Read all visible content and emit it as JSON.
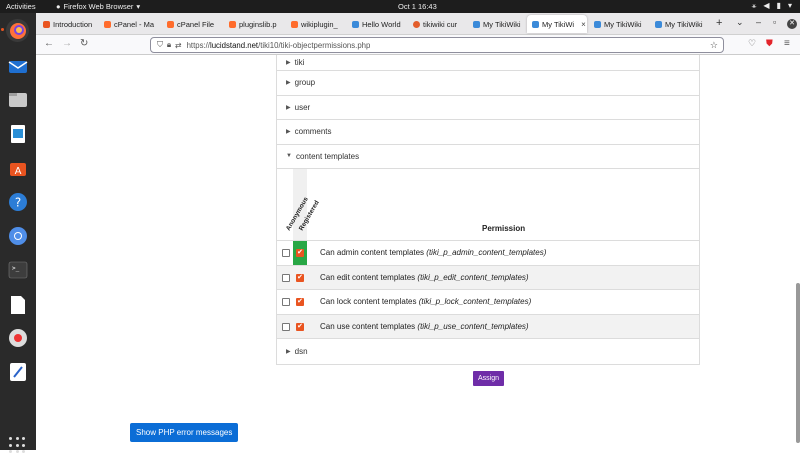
{
  "topbar": {
    "activities": "Activities",
    "app_name": "Firefox Web Browser",
    "clock": "Oct 1  16:43"
  },
  "browser": {
    "tabs": [
      {
        "label": "Introduction",
        "color": "#e95420"
      },
      {
        "label": "cPanel - Ma",
        "color": "#ff6c2c"
      },
      {
        "label": "cPanel File",
        "color": "#ff6c2c"
      },
      {
        "label": "pluginslib.p",
        "color": "#ff6c2c"
      },
      {
        "label": "wikiplugin_",
        "color": "#ff6c2c"
      },
      {
        "label": "Hello World",
        "color": "#3b8ad9"
      },
      {
        "label": "tikiwiki cur",
        "color": "#e35d2b"
      },
      {
        "label": "My TikiWiki",
        "color": "#3b8ad9"
      },
      {
        "label": "My TikiWi",
        "color": "#3b8ad9"
      },
      {
        "label": "My TikiWiki",
        "color": "#3b8ad9"
      },
      {
        "label": "My TikiWiki",
        "color": "#3b8ad9"
      }
    ],
    "active_tab_close": "×",
    "new_tab": "+",
    "url_prefix": "https://",
    "url_host": "lucidstand.net",
    "url_path": "/tiki10/tiki-objectpermissions.php"
  },
  "page": {
    "groups": [
      "tiki",
      "group",
      "user",
      "comments",
      "content templates"
    ],
    "last_group": "dsn",
    "columns": [
      "Anonymous",
      "Registered"
    ],
    "permission_header": "Permission",
    "permissions": [
      {
        "label": "Can admin content templates",
        "code": "(tiki_p_admin_content_templates)"
      },
      {
        "label": "Can edit content templates",
        "code": "(tiki_p_edit_content_templates)"
      },
      {
        "label": "Can lock content templates",
        "code": "(tiki_p_lock_content_templates)"
      },
      {
        "label": "Can use content templates",
        "code": "(tiki_p_use_content_templates)"
      }
    ],
    "assign_label": "Assign",
    "php_errors_label": "Show PHP error messages"
  }
}
